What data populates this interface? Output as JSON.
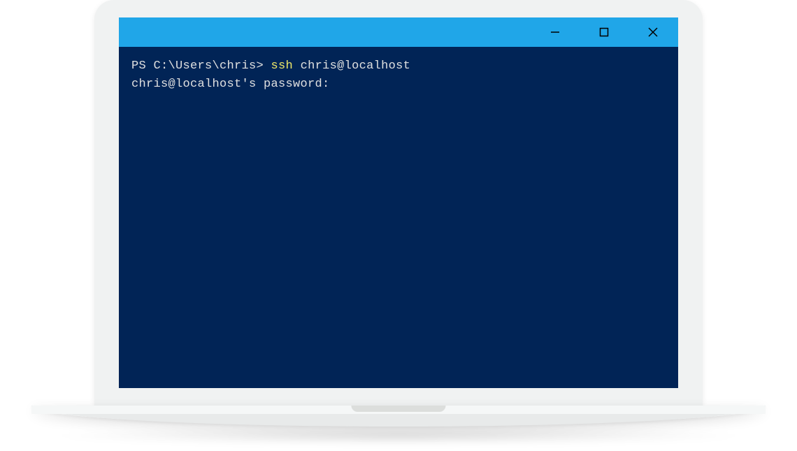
{
  "titlebar": {
    "minimize_icon": "minimize-icon",
    "maximize_icon": "maximize-icon",
    "close_icon": "close-icon"
  },
  "terminal": {
    "line1": {
      "prompt": "PS C:\\Users\\chris> ",
      "command": "ssh",
      "args": " chris@localhost"
    },
    "line2": "chris@localhost's password:"
  },
  "colors": {
    "titlebar_bg": "#20a6e8",
    "terminal_bg": "#012456",
    "terminal_fg": "#e0e0e0",
    "cmd_highlight": "#f0e868"
  }
}
